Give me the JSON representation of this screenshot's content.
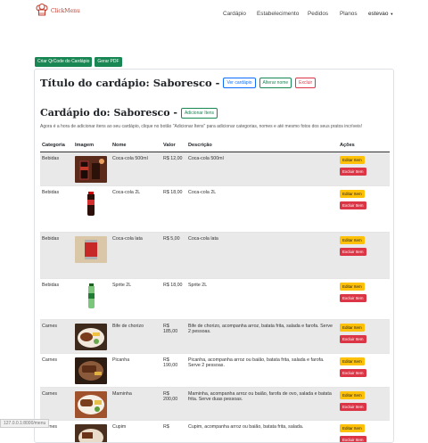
{
  "nav": {
    "brand": "ClickMenu",
    "links": [
      "Cardápio",
      "Estabelecimento",
      "Pedidos",
      "Planos"
    ],
    "user": "estevao"
  },
  "actions": {
    "qrcode": "Criar QrCode do Cardápio",
    "pdf": "Gerar PDF"
  },
  "header": {
    "title": "Título do cardápio: Saboresco -",
    "view": "Ver cardápio",
    "rename": "Alterar nome",
    "delete": "Excluir",
    "menu_title": "Cardápio do: Saboresco -",
    "add": "Adicionar Itens",
    "hint": "Agora é a hora de adicionar itens ao seu cardápio, clique no botão \"Adicionar Itens\" para adicionar categorias, nomes e até mesmo fotos dos seus pratos incríveis!"
  },
  "table": {
    "columns": [
      "Categoria",
      "Imagem",
      "Nome",
      "Valor",
      "Descrição",
      "Ações"
    ],
    "edit_label": "Editar Item",
    "delete_label": "Excluir Item",
    "rows": [
      {
        "category": "Bebidas",
        "name": "Coca-cola 500ml",
        "price": "R$ 12,00",
        "desc": "Coca-cola 500ml"
      },
      {
        "category": "Bebidas",
        "name": "Coca-cola 2L",
        "price": "R$ 18,00",
        "desc": "Coca-cola 2L"
      },
      {
        "category": "Bebidas",
        "name": "Coca-cola lata",
        "price": "R$ 5,00",
        "desc": "Coca-cola lata"
      },
      {
        "category": "Bebidas",
        "name": "Sprite 2L",
        "price": "R$ 18,00",
        "desc": "Sprite 2L"
      },
      {
        "category": "Carnes",
        "name": "Bife de chorizo",
        "price": "R$ 185,00",
        "desc": "Bife de chorizo, acompanha arroz, batata frita, salada e farofa. Serve 2 pessoas."
      },
      {
        "category": "Carnes",
        "name": "Picanha",
        "price": "R$ 190,00",
        "desc": "Picanha, acompanha arroz ou baião, batata frita, salada e farofa. Serve 2 pessoas."
      },
      {
        "category": "Carnes",
        "name": "Maminha",
        "price": "R$ 200,00",
        "desc": "Maminha, acompanha arroz ou baião, farofa de ovo, salada e batata frita. Serve duas pessoas."
      },
      {
        "category": "Carnes",
        "name": "Cupim",
        "price": "R$",
        "desc": "Cupim, acompanha arroz ou baião, batata frita, salada."
      }
    ]
  },
  "status": "127.0.0.1:8000/menu"
}
